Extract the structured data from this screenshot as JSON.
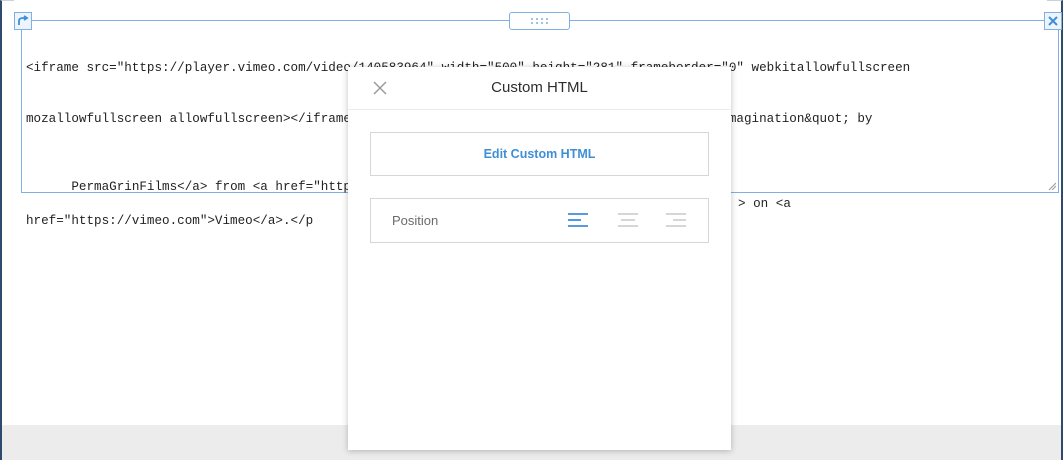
{
  "editor": {
    "code_line1": "<iframe src=\"https://player.vimeo.com/video/140583964\" width=\"500\" height=\"281\" frameborder=\"0\" webkitallowfullscreen",
    "code_line2": "mozallowfullscreen allowfullscreen></iframe> <p><a href=\"https://vimeo.com/140583964\">&quot;Imagination&quot; by",
    "code_line3_left": "PermaGrinFilms</a> from <a href=\"https",
    "code_line3_right": "> on <a",
    "code_line4": "href=\"https://vimeo.com\">Vimeo</a>.</p"
  },
  "modal": {
    "title": "Custom HTML",
    "edit_button": "Edit Custom HTML",
    "position_label": "Position",
    "alignment_options": [
      "align-left",
      "align-center",
      "align-right"
    ],
    "selected_alignment": "align-left"
  },
  "colors": {
    "accent": "#3f8fd6",
    "editor_border": "#7fb0e3",
    "inactive_icon": "#c8c8c8",
    "frame_border": "#2f4a6d"
  }
}
